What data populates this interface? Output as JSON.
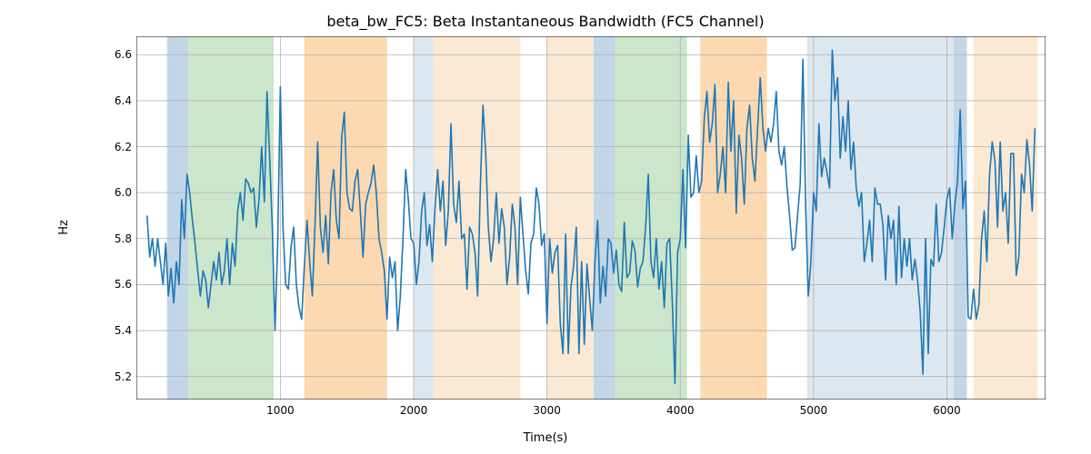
{
  "chart_data": {
    "type": "line",
    "title": "beta_bw_FC5: Beta Instantaneous Bandwidth (FC5 Channel)",
    "xlabel": "Time(s)",
    "ylabel": "Hz",
    "xlim": [
      -80,
      6740
    ],
    "ylim": [
      5.1,
      6.68
    ],
    "xticks": [
      1000,
      2000,
      3000,
      4000,
      5000,
      6000
    ],
    "yticks": [
      5.2,
      5.4,
      5.6,
      5.8,
      6.0,
      6.2,
      6.4,
      6.6
    ],
    "line_color": "#1f77b4",
    "grid_color": "#b0b0b0",
    "grid": true,
    "bands": [
      {
        "x0": 150,
        "x1": 310,
        "color": "#c2d6e8"
      },
      {
        "x0": 310,
        "x1": 950,
        "color": "#cbe6cb"
      },
      {
        "x0": 1180,
        "x1": 1800,
        "color": "#fcd9b1"
      },
      {
        "x0": 2000,
        "x1": 2150,
        "color": "#dde7f0"
      },
      {
        "x0": 2150,
        "x1": 2800,
        "color": "#fbe9d4"
      },
      {
        "x0": 3000,
        "x1": 3350,
        "color": "#fbe9d4"
      },
      {
        "x0": 3350,
        "x1": 3510,
        "color": "#c2d6e8"
      },
      {
        "x0": 3510,
        "x1": 4050,
        "color": "#cbe6cb"
      },
      {
        "x0": 4150,
        "x1": 4650,
        "color": "#fcd9b1"
      },
      {
        "x0": 4950,
        "x1": 6050,
        "color": "#dde7f0"
      },
      {
        "x0": 6050,
        "x1": 6150,
        "color": "#c2d6e8"
      },
      {
        "x0": 6200,
        "x1": 6680,
        "color": "#fbe9d4"
      }
    ],
    "x": [
      0,
      20,
      40,
      60,
      80,
      100,
      120,
      140,
      160,
      180,
      200,
      220,
      240,
      260,
      280,
      300,
      320,
      340,
      360,
      380,
      400,
      420,
      440,
      460,
      480,
      500,
      520,
      540,
      560,
      580,
      600,
      620,
      640,
      660,
      680,
      700,
      720,
      740,
      760,
      780,
      800,
      820,
      840,
      860,
      880,
      900,
      920,
      940,
      960,
      980,
      1000,
      1020,
      1040,
      1060,
      1080,
      1100,
      1120,
      1140,
      1160,
      1180,
      1200,
      1220,
      1240,
      1260,
      1280,
      1300,
      1320,
      1340,
      1360,
      1380,
      1400,
      1420,
      1440,
      1460,
      1480,
      1500,
      1520,
      1540,
      1560,
      1580,
      1600,
      1620,
      1640,
      1660,
      1680,
      1700,
      1720,
      1740,
      1760,
      1780,
      1800,
      1820,
      1840,
      1860,
      1880,
      1900,
      1920,
      1940,
      1960,
      1980,
      2000,
      2020,
      2040,
      2060,
      2080,
      2100,
      2120,
      2140,
      2160,
      2180,
      2200,
      2220,
      2240,
      2260,
      2280,
      2300,
      2320,
      2340,
      2360,
      2380,
      2400,
      2420,
      2440,
      2460,
      2480,
      2500,
      2520,
      2540,
      2560,
      2580,
      2600,
      2620,
      2640,
      2660,
      2680,
      2700,
      2720,
      2740,
      2760,
      2780,
      2800,
      2820,
      2840,
      2860,
      2880,
      2900,
      2920,
      2940,
      2960,
      2980,
      3000,
      3020,
      3040,
      3060,
      3080,
      3100,
      3120,
      3140,
      3160,
      3180,
      3200,
      3220,
      3240,
      3260,
      3280,
      3300,
      3320,
      3340,
      3360,
      3380,
      3400,
      3420,
      3440,
      3460,
      3480,
      3500,
      3520,
      3540,
      3560,
      3580,
      3600,
      3620,
      3640,
      3660,
      3680,
      3700,
      3720,
      3740,
      3760,
      3780,
      3800,
      3820,
      3840,
      3860,
      3880,
      3900,
      3920,
      3940,
      3960,
      3980,
      4000,
      4020,
      4040,
      4060,
      4080,
      4100,
      4120,
      4140,
      4160,
      4180,
      4200,
      4220,
      4240,
      4260,
      4280,
      4300,
      4320,
      4340,
      4360,
      4380,
      4400,
      4420,
      4440,
      4460,
      4480,
      4500,
      4520,
      4540,
      4560,
      4580,
      4600,
      4620,
      4640,
      4660,
      4680,
      4700,
      4720,
      4740,
      4760,
      4780,
      4800,
      4820,
      4840,
      4860,
      4880,
      4900,
      4920,
      4940,
      4960,
      4980,
      5000,
      5020,
      5040,
      5060,
      5080,
      5100,
      5120,
      5140,
      5160,
      5180,
      5200,
      5220,
      5240,
      5260,
      5280,
      5300,
      5320,
      5340,
      5360,
      5380,
      5400,
      5420,
      5440,
      5460,
      5480,
      5500,
      5520,
      5540,
      5560,
      5580,
      5600,
      5620,
      5640,
      5660,
      5680,
      5700,
      5720,
      5740,
      5760,
      5780,
      5800,
      5820,
      5840,
      5860,
      5880,
      5900,
      5920,
      5940,
      5960,
      5980,
      6000,
      6020,
      6040,
      6060,
      6080,
      6100,
      6120,
      6140,
      6160,
      6180,
      6200,
      6220,
      6240,
      6260,
      6280,
      6300,
      6320,
      6340,
      6360,
      6380,
      6400,
      6420,
      6440,
      6460,
      6480,
      6500,
      6520,
      6540,
      6560,
      6580,
      6600,
      6620,
      6640,
      6660
    ],
    "y": [
      5.9,
      5.72,
      5.8,
      5.68,
      5.8,
      5.7,
      5.6,
      5.78,
      5.55,
      5.67,
      5.52,
      5.7,
      5.6,
      5.97,
      5.8,
      6.08,
      6.0,
      5.88,
      5.78,
      5.66,
      5.55,
      5.66,
      5.62,
      5.5,
      5.6,
      5.7,
      5.62,
      5.74,
      5.6,
      5.66,
      5.8,
      5.6,
      5.78,
      5.68,
      5.92,
      6.0,
      5.88,
      6.06,
      6.04,
      6.0,
      6.02,
      5.85,
      5.97,
      6.2,
      5.96,
      6.44,
      6.15,
      5.84,
      5.4,
      5.78,
      6.46,
      5.85,
      5.6,
      5.58,
      5.76,
      5.85,
      5.6,
      5.5,
      5.45,
      5.68,
      5.88,
      5.7,
      5.55,
      5.86,
      6.22,
      5.85,
      5.74,
      5.9,
      5.69,
      6.0,
      6.1,
      5.88,
      5.8,
      6.24,
      6.35,
      6.0,
      5.93,
      5.92,
      6.05,
      6.1,
      5.92,
      5.72,
      5.95,
      6.0,
      6.04,
      6.12,
      6.0,
      5.8,
      5.74,
      5.66,
      5.45,
      5.72,
      5.63,
      5.7,
      5.4,
      5.55,
      5.8,
      6.1,
      5.97,
      5.8,
      5.78,
      5.6,
      5.7,
      5.92,
      6.0,
      5.77,
      5.86,
      5.7,
      5.93,
      6.1,
      5.92,
      6.05,
      5.77,
      5.92,
      6.3,
      5.95,
      5.87,
      6.05,
      5.8,
      5.82,
      5.58,
      5.85,
      5.82,
      5.74,
      5.55,
      6.02,
      6.38,
      6.18,
      5.85,
      5.7,
      5.8,
      6.0,
      5.78,
      5.93,
      5.85,
      5.6,
      5.72,
      5.95,
      5.85,
      5.6,
      5.98,
      5.82,
      5.66,
      5.56,
      5.78,
      5.82,
      6.02,
      5.95,
      5.77,
      5.82,
      5.43,
      5.8,
      5.65,
      5.74,
      5.77,
      5.43,
      5.3,
      5.82,
      5.3,
      5.59,
      5.68,
      5.85,
      5.3,
      5.7,
      5.34,
      5.69,
      5.54,
      5.4,
      5.7,
      5.88,
      5.52,
      5.68,
      5.55,
      5.8,
      5.78,
      5.65,
      5.75,
      5.6,
      5.57,
      5.87,
      5.63,
      5.65,
      5.79,
      5.75,
      5.59,
      5.67,
      5.7,
      5.85,
      6.08,
      5.7,
      5.63,
      5.8,
      5.58,
      5.7,
      5.5,
      5.78,
      5.8,
      5.53,
      5.17,
      5.74,
      5.8,
      6.1,
      5.76,
      6.25,
      5.98,
      6.0,
      6.16,
      6.0,
      6.05,
      6.32,
      6.44,
      6.22,
      6.3,
      6.47,
      6.0,
      6.08,
      6.2,
      6.0,
      6.48,
      6.18,
      6.4,
      5.91,
      6.25,
      6.15,
      5.95,
      6.28,
      6.38,
      6.15,
      6.05,
      6.28,
      6.5,
      6.28,
      6.18,
      6.28,
      6.22,
      6.3,
      6.44,
      6.18,
      6.12,
      6.2,
      6.03,
      5.9,
      5.75,
      5.76,
      5.9,
      6.04,
      6.58,
      5.95,
      5.55,
      5.7,
      6.0,
      5.92,
      6.3,
      6.07,
      6.15,
      6.09,
      6.02,
      6.62,
      6.4,
      6.5,
      6.15,
      6.33,
      6.18,
      6.4,
      6.1,
      6.22,
      6.02,
      5.94,
      6.0,
      5.7,
      5.78,
      5.88,
      5.7,
      6.02,
      5.95,
      5.95,
      5.86,
      5.62,
      5.9,
      5.8,
      5.88,
      5.6,
      5.94,
      5.63,
      5.8,
      5.68,
      5.8,
      5.62,
      5.71,
      5.62,
      5.48,
      5.21,
      5.8,
      5.3,
      5.71,
      5.68,
      5.95,
      5.7,
      5.74,
      5.85,
      5.97,
      6.02,
      5.8,
      5.95,
      6.05,
      6.36,
      5.93,
      6.05,
      5.46,
      5.45,
      5.58,
      5.45,
      5.51,
      5.8,
      5.92,
      5.7,
      6.08,
      6.22,
      6.14,
      5.85,
      6.22,
      5.92,
      6.0,
      5.78,
      6.17,
      6.17,
      5.64,
      5.72,
      6.08,
      6.0,
      6.23,
      6.12,
      5.92,
      6.28
    ]
  }
}
